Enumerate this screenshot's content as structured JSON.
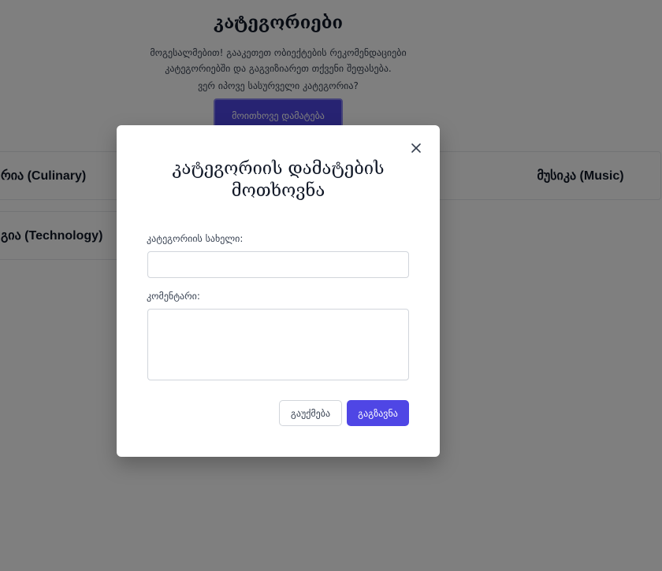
{
  "page": {
    "title": "კატეგორიები",
    "description": "მოგესალმებით! გააკეთეთ ობიექტების რეკომენდაციები კატეგორიებში და გაგვიზიარეთ თქვენი შეფასება.",
    "question": "ვერ იპოვე სასურველი კატეგორია?",
    "request_button": "მოითხოვე დამატება"
  },
  "categories": [
    {
      "label": "რია (Culinary)"
    },
    {
      "label": "მუსიკა (Music)"
    },
    {
      "label": "გია (Technology)"
    }
  ],
  "modal": {
    "title": "კატეგორიის დამატების მოთხოვნა",
    "close_icon": "close-icon",
    "name_label": "კატეგორიის სახელი:",
    "name_value": "",
    "comment_label": "კომენტარი:",
    "comment_value": "",
    "cancel_label": "გაუქმება",
    "submit_label": "გაგზავნა"
  },
  "colors": {
    "accent": "#4f46e5",
    "overlay": "rgba(0,0,0,0.5)"
  }
}
